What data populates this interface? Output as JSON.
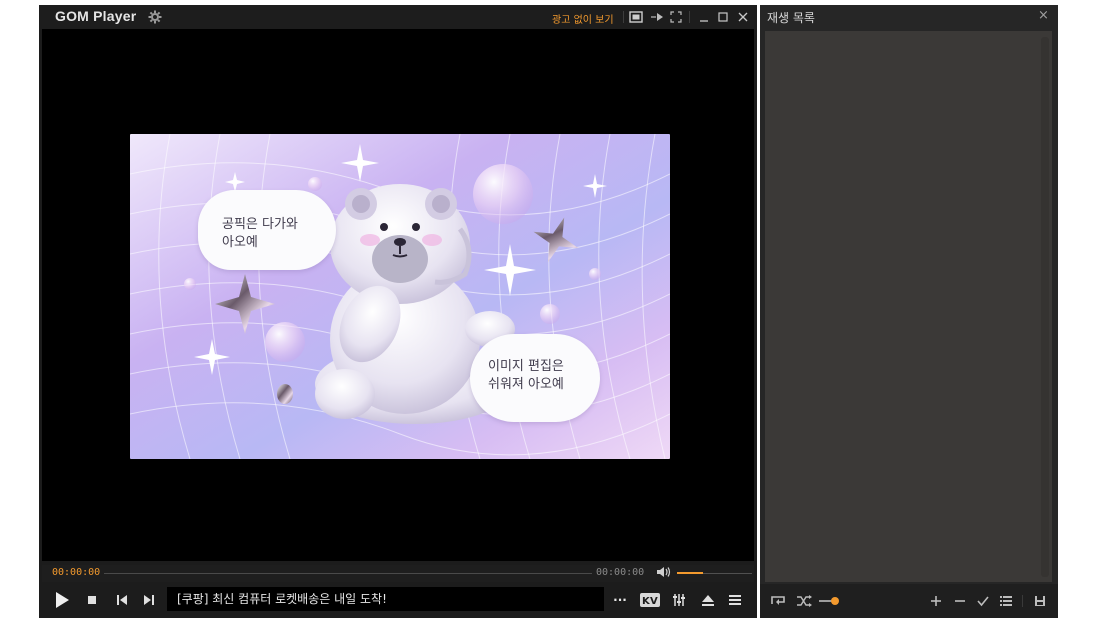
{
  "titlebar": {
    "brand": "GOM Player",
    "ad_free_label": "광고 없이 보기",
    "icons": [
      "gear-icon",
      "ad-free-badge-icon",
      "pip-icon",
      "fullscreen-icon",
      "minimize-icon",
      "maximize-icon",
      "close-icon"
    ]
  },
  "video": {
    "bubble_left": "공픽은 다가와\n아오예",
    "bubble_right": "이미지 편집은\n쉬워져 아오예"
  },
  "seekbar": {
    "current_time": "00:00:00",
    "total_time": "00:00:00",
    "progress": 0,
    "volume": 0.34
  },
  "controls": {
    "ticker_text": "[쿠팡] 최신 컴퓨터 로켓배송은 내일 도착!",
    "more_label": "···",
    "kv_label": "K"
  },
  "playlist": {
    "title": "재생 목록",
    "close_label": "×",
    "accent": "#f39a2e"
  },
  "colors": {
    "accent": "#f39a2e",
    "chrome_bg": "#1c1c1c",
    "playlist_area": "#3b3937"
  }
}
